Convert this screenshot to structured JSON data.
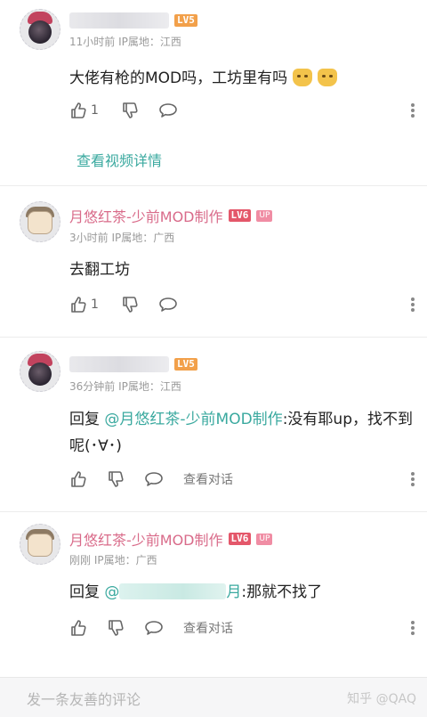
{
  "comments": [
    {
      "username": "",
      "level": "LV5",
      "up_badge": "",
      "time": "11小时前",
      "ip": "IP属地：江西",
      "text": "大佬有枪的MOD吗，工坊里有吗",
      "emojis": [
        "doge-emoji",
        "doge-emoji"
      ],
      "like_count": "1",
      "view_conversation": ""
    },
    {
      "username": "月悠红茶-少前MOD制作",
      "level": "LV6",
      "up_badge": "UP",
      "time": "3小时前",
      "ip": "IP属地：广西",
      "text": "去翻工坊",
      "like_count": "1",
      "view_conversation": ""
    },
    {
      "username": "",
      "level": "LV5",
      "up_badge": "",
      "time": "36分钟前",
      "ip": "IP属地：江西",
      "reply_prefix": "回复",
      "mention": "@月悠红茶-少前MOD制作",
      "text": ":没有耶up，找不到呢(･∀･)",
      "like_count": "",
      "view_conversation": "查看对话"
    },
    {
      "username": "月悠红茶-少前MOD制作",
      "level": "LV6",
      "up_badge": "UP",
      "time": "刚刚",
      "ip": "IP属地：广西",
      "reply_prefix": "回复",
      "mention_start": "@",
      "mention_end": "月",
      "text": ":那就不找了",
      "like_count": "",
      "view_conversation": "查看对话"
    }
  ],
  "video_link": "查看视频详情",
  "input": {
    "placeholder": "发一条友善的评论"
  },
  "watermark": "知乎 @QAQ"
}
